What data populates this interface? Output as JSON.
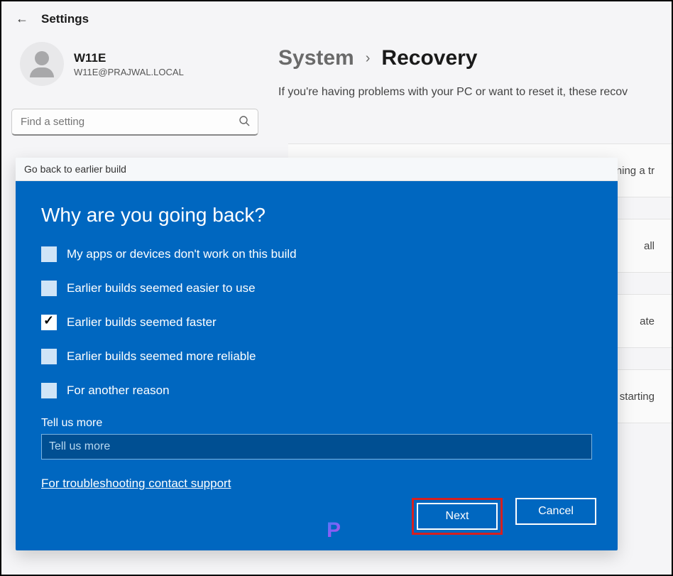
{
  "app_title": "Settings",
  "user": {
    "name": "W11E",
    "email": "W11E@PRAJWAL.LOCAL"
  },
  "search": {
    "placeholder": "Find a setting"
  },
  "breadcrumb": {
    "parent": "System",
    "current": "Recovery"
  },
  "description": "If you're having problems with your PC or want to reset it, these recov",
  "bg_items": [
    "running a tr",
    "all",
    "ate",
    "starting"
  ],
  "dialog": {
    "title": "Go back to earlier build",
    "heading": "Why are you going back?",
    "options": [
      {
        "label": "My apps or devices don't work on this build",
        "checked": false
      },
      {
        "label": "Earlier builds seemed easier to use",
        "checked": false
      },
      {
        "label": "Earlier builds seemed faster",
        "checked": true
      },
      {
        "label": "Earlier builds seemed more reliable",
        "checked": false
      },
      {
        "label": "For another reason",
        "checked": false
      }
    ],
    "tell_more_label": "Tell us more",
    "tell_more_placeholder": "Tell us more",
    "support_link": "For troubleshooting contact support",
    "next_btn": "Next",
    "cancel_btn": "Cancel"
  }
}
